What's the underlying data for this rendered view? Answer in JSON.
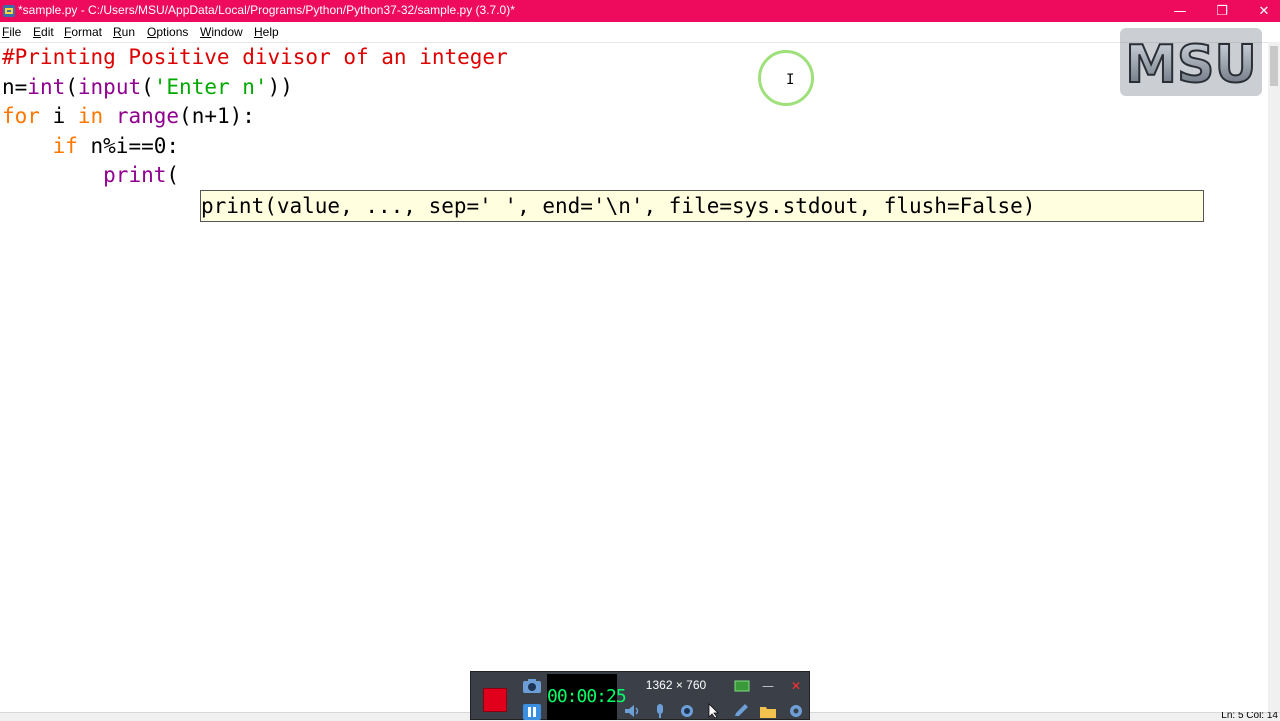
{
  "window": {
    "title": "*sample.py - C:/Users/MSU/AppData/Local/Programs/Python/Python37-32/sample.py (3.7.0)*",
    "min_glyph": "—",
    "max_glyph": "❐",
    "close_glyph": "✕",
    "accent_color": "#ee0a5d"
  },
  "menu": {
    "items": [
      "File",
      "Edit",
      "Format",
      "Run",
      "Options",
      "Window",
      "Help"
    ]
  },
  "editor": {
    "lines": [
      {
        "segments": [
          {
            "t": "#Printing Positive divisor of an integer",
            "c": "comment"
          }
        ]
      },
      {
        "segments": [
          {
            "t": "n=",
            "c": "plain"
          },
          {
            "t": "int",
            "c": "builtin"
          },
          {
            "t": "(",
            "c": "plain"
          },
          {
            "t": "input",
            "c": "builtin"
          },
          {
            "t": "(",
            "c": "plain"
          },
          {
            "t": "'Enter n'",
            "c": "str"
          },
          {
            "t": "))",
            "c": "plain"
          }
        ]
      },
      {
        "segments": [
          {
            "t": "for",
            "c": "kw"
          },
          {
            "t": " i ",
            "c": "plain"
          },
          {
            "t": "in",
            "c": "kw"
          },
          {
            "t": " ",
            "c": "plain"
          },
          {
            "t": "range",
            "c": "builtin"
          },
          {
            "t": "(n+1):",
            "c": "plain"
          }
        ]
      },
      {
        "segments": [
          {
            "t": "    ",
            "c": "plain"
          },
          {
            "t": "if",
            "c": "kw"
          },
          {
            "t": " n%i==0:",
            "c": "plain"
          }
        ]
      },
      {
        "segments": [
          {
            "t": "        ",
            "c": "plain"
          },
          {
            "t": "print",
            "c": "builtin"
          },
          {
            "t": "(",
            "c": "plain"
          }
        ]
      }
    ],
    "calltip": "print(value, ..., sep=' ', end='\\n', file=sys.stdout, flush=False)"
  },
  "logo": {
    "text": "MSU"
  },
  "status": {
    "position": "Ln: 5   Col: 14"
  },
  "recorder": {
    "time": "00:00:25",
    "size": "1362 × 760"
  }
}
